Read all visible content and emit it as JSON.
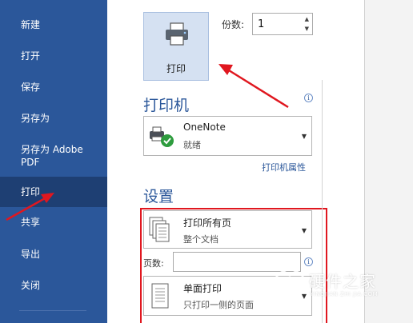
{
  "sidebar": {
    "items": [
      {
        "label": "新建"
      },
      {
        "label": "打开"
      },
      {
        "label": "保存"
      },
      {
        "label": "另存为"
      },
      {
        "label": "另存为 Adobe"
      },
      {
        "label": "PDF"
      },
      {
        "label": "打印",
        "active": true
      },
      {
        "label": "共享"
      },
      {
        "label": "导出"
      },
      {
        "label": "关闭"
      }
    ]
  },
  "print": {
    "button_label": "打印",
    "copies_label": "份数:",
    "copies_value": "1"
  },
  "printer": {
    "section_title": "打印机",
    "name": "OneNote",
    "status": "就绪",
    "properties_link": "打印机属性"
  },
  "settings": {
    "section_title": "设置",
    "range": {
      "title": "打印所有页",
      "subtitle": "整个文档"
    },
    "pages_label": "页数:",
    "pages_value": "",
    "sides": {
      "title": "单面打印",
      "subtitle": "只打印一侧的页面"
    }
  },
  "watermark": {
    "text": "硬件之家",
    "subtext": "YINGJIAN ZHI JIA.COM"
  },
  "colors": {
    "sidebar_bg": "#2b579a",
    "sidebar_active": "#1e3f73",
    "accent": "#2b579a",
    "annotation_red": "#e0171f"
  }
}
